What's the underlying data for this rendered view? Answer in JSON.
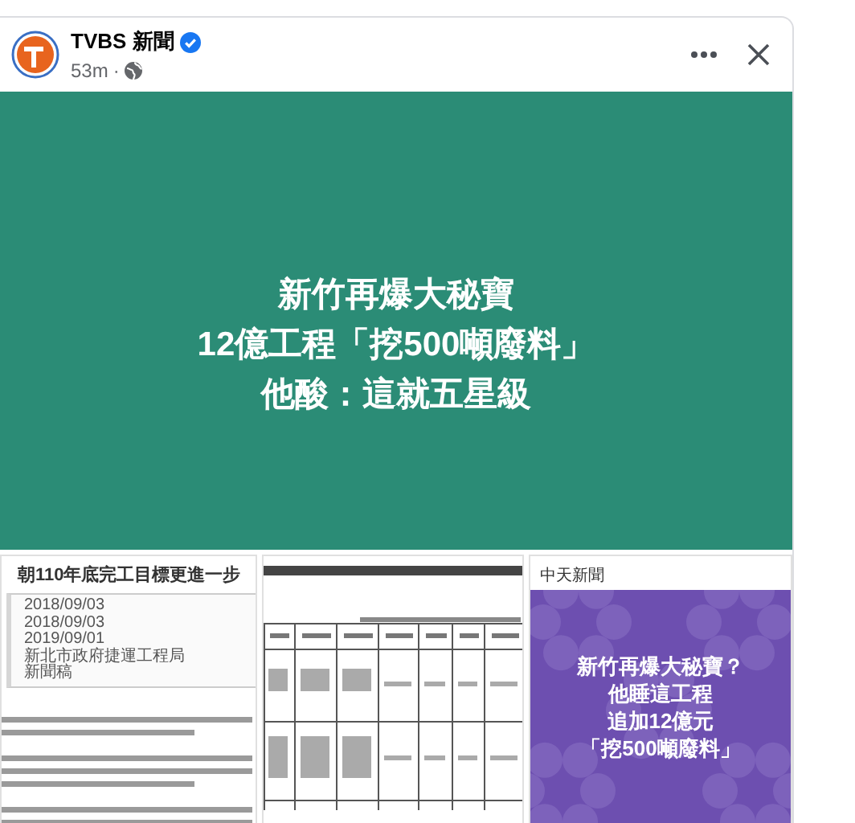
{
  "post": {
    "author": "TVBS 新聞",
    "verified": true,
    "time": "53m",
    "separator": "·",
    "public": true,
    "banner": {
      "lines": [
        "新竹再爆大秘寶",
        "12億工程「挖500噸廢料」",
        "他酸：這就五星級"
      ]
    },
    "attachments": [
      {
        "kind": "article",
        "title": "朝110年底完工目標更進一步",
        "meta": [
          "2018/09/03",
          "2018/09/03",
          "2019/09/01",
          "新北市政府捷運工程局",
          "新聞稿"
        ]
      },
      {
        "kind": "table"
      },
      {
        "kind": "share",
        "source": "中天新聞",
        "lines": [
          "新竹再爆大秘寶？",
          "他睡這工程",
          "追加12億元",
          "「挖500噸廢料」"
        ]
      }
    ]
  }
}
